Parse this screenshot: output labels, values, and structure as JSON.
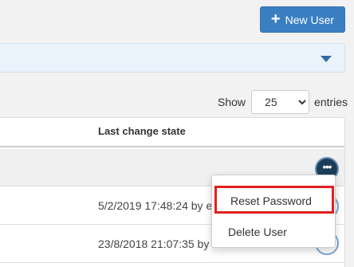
{
  "header": {
    "new_user_label": "New User"
  },
  "pagination": {
    "show_label": "Show",
    "page_size": "25",
    "page_size_options": [
      "25"
    ],
    "entries_label": "entries"
  },
  "table": {
    "columns": [
      "Last change state"
    ],
    "rows": [
      {
        "last_change_state": ""
      },
      {
        "last_change_state": "5/2/2019 17:48:24 by e"
      },
      {
        "last_change_state": "23/8/2018 21:07:35 by"
      }
    ]
  },
  "row_actions": {
    "more_label": "•••",
    "menu": [
      {
        "label": "Reset Password",
        "highlighted": true
      },
      {
        "label": "Delete User"
      }
    ]
  },
  "colors": {
    "primary": "#3a7fc1",
    "filter_bg": "#eaf3fb",
    "highlight": "#e02020",
    "action_button": "#1c3d5a"
  }
}
